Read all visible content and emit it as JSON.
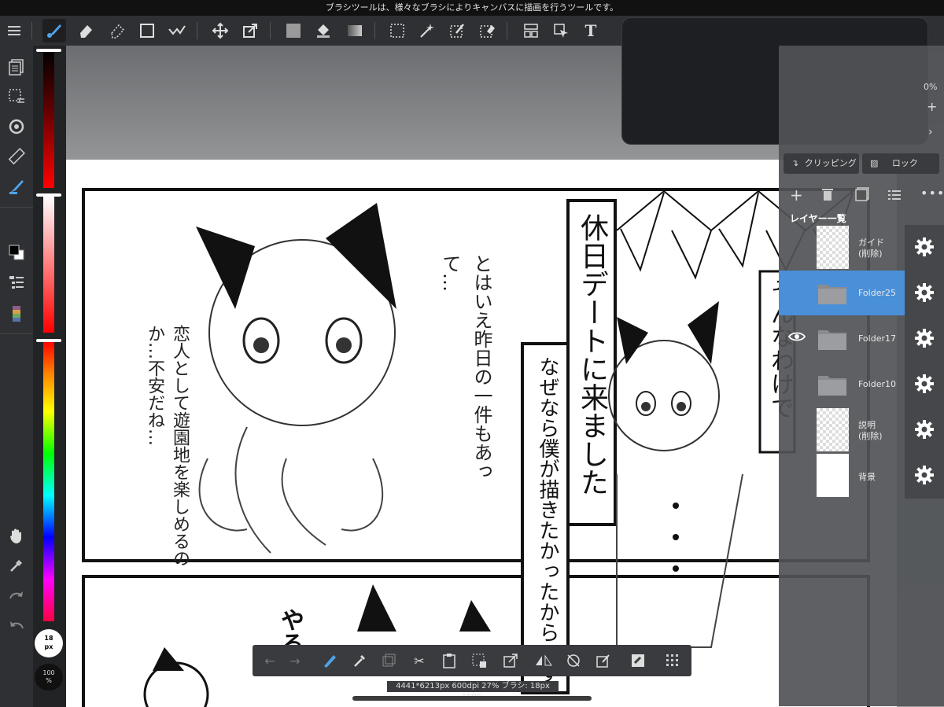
{
  "status": {
    "tooltip": "ブラシツールは、様々なブラシによりキャンバスに描画を行うツールです。"
  },
  "toolbar": {
    "menu_icon": "menu-icon",
    "tools": [
      "brush-icon",
      "eraser-icon",
      "blur-icon",
      "rect-icon",
      "pen-check-icon",
      "move-icon",
      "transform-icon",
      "fill-color-icon",
      "bucket-icon",
      "gradient-icon",
      "select-rect-icon",
      "magic-wand-icon",
      "select-pen-icon",
      "select-eraser-icon",
      "frame-icon",
      "cursor-icon",
      "text-icon"
    ],
    "text_tool_label": "T"
  },
  "left_tools": {
    "items": [
      "layers-icon",
      "selection-icon",
      "rotate-icon",
      "ruler-icon",
      "brush-color-icon",
      "color-swatch-icon",
      "layer-list-icon",
      "palette-icon",
      "hand-icon",
      "eyedropper-icon",
      "redo-icon",
      "undo-icon"
    ]
  },
  "brush": {
    "size": "18",
    "size_unit": "px",
    "opacity": "100",
    "opacity_unit": "%"
  },
  "layer_panel": {
    "zoom_hint": "0%",
    "clipping_label": "クリッピング",
    "lock_label": "ロック",
    "list_title": "レイヤー一覧",
    "layers": [
      {
        "name": "ガイド",
        "sub": "(削除)",
        "selected": false,
        "visible_icon": false,
        "folder": false
      },
      {
        "name": "Folder25",
        "sub": "",
        "selected": true,
        "visible_icon": false,
        "folder": true
      },
      {
        "name": "Folder17",
        "sub": "",
        "selected": false,
        "visible_icon": true,
        "folder": true
      },
      {
        "name": "Folder10",
        "sub": "",
        "selected": false,
        "visible_icon": false,
        "folder": true
      },
      {
        "name": "説明",
        "sub": "(削除)",
        "selected": false,
        "visible_icon": false,
        "folder": false
      },
      {
        "name": "背景",
        "sub": "",
        "selected": false,
        "visible_icon": false,
        "folder": false
      }
    ]
  },
  "canvas": {
    "title_text": "休日デートに来ました",
    "sub_text": "なぜなら僕が描きたかったからです",
    "text_left1": "とはいえ昨日の一件もあって…",
    "text_left2": "恋人として遊園地を楽しめるのか…不安だね…",
    "text_right": "そんなわけで",
    "text_bottom": "やるっ"
  },
  "bottom": {
    "info": "4441*6213px 600dpi 27% ブラシ: 18px 100%"
  }
}
